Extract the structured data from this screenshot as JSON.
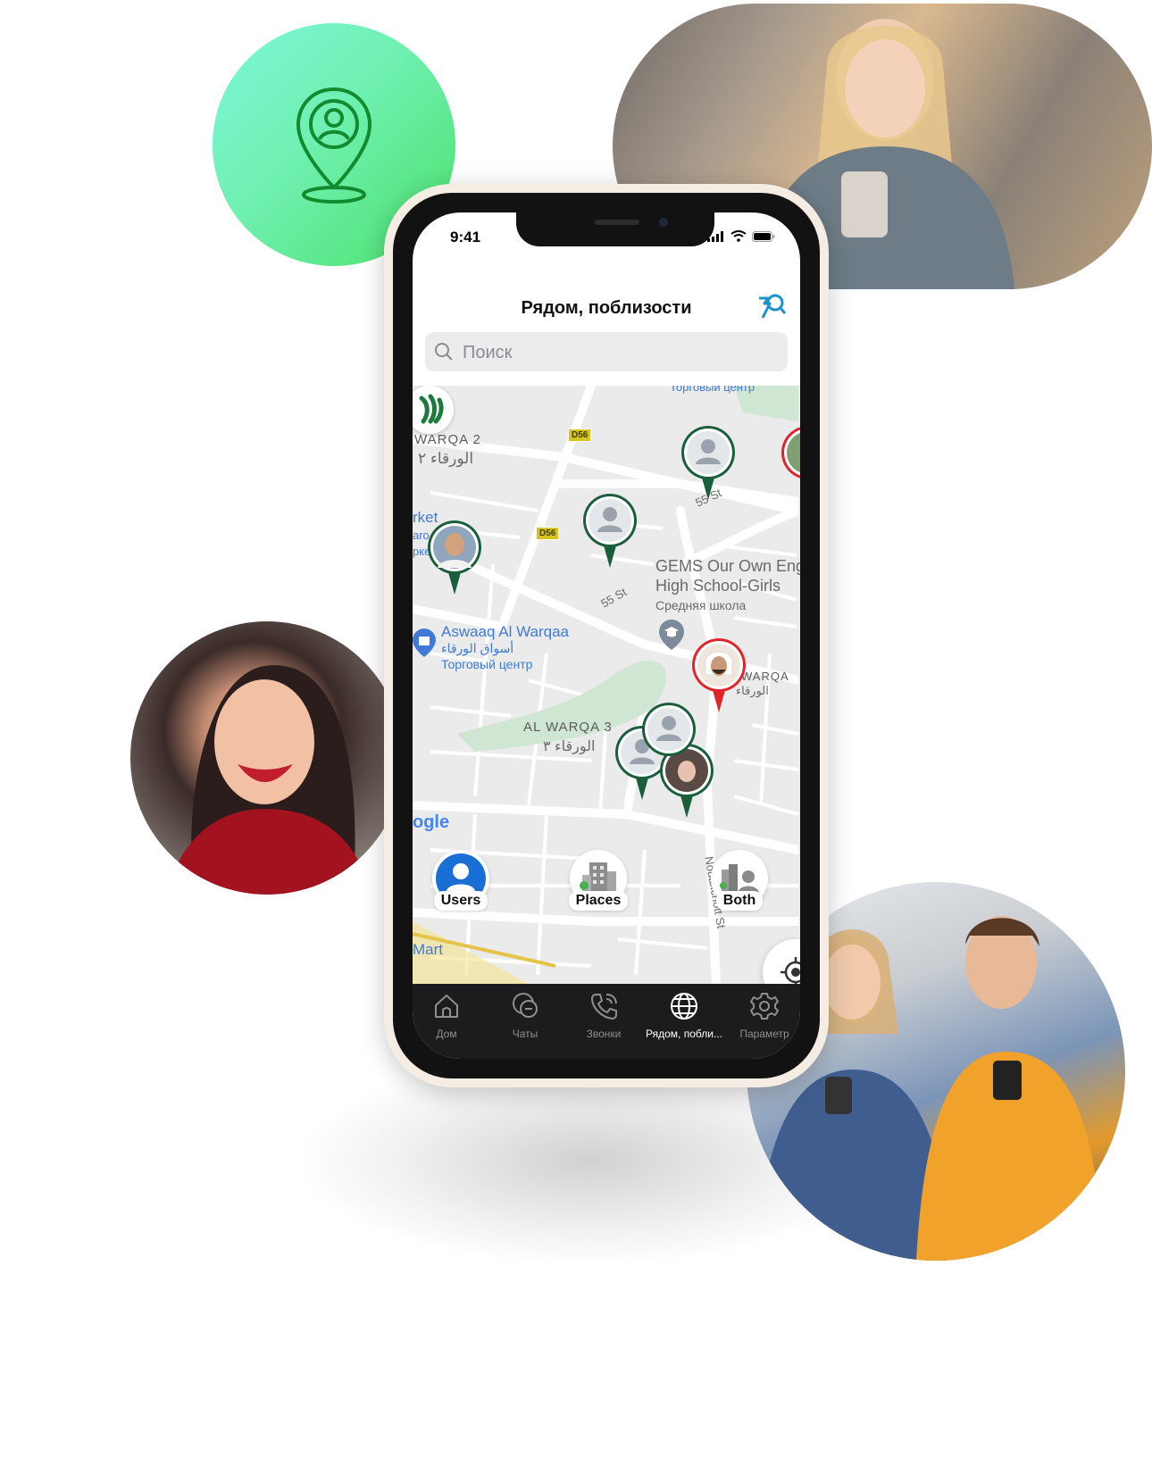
{
  "status_bar": {
    "time": "9:41"
  },
  "header": {
    "title": "Рядом, поблизости"
  },
  "search": {
    "placeholder": "Поиск"
  },
  "map": {
    "labels": {
      "warqa2_en": "WARQA 2",
      "warqa2_ar": "الورقاء ٢",
      "market_en": "rket",
      "market_a": "aro",
      "market_b": "рке",
      "aswaaq_en": "Aswaaq Al Warqaa",
      "aswaaq_ar": "أسواق الورقاء",
      "aswaaq_ru": "Торговый центр",
      "top_ru": "Торговый центр",
      "gems_1": "GEMS Our Own Eng",
      "gems_2": "High School-Girls",
      "gems_ru": "Средняя школа",
      "warqa_right_en": "WARQA",
      "warqa_right_ar": "الورقاء",
      "warqa3_en": "AL WARQA 3",
      "warqa3_ar": "الورقاء ٣",
      "st55_a": "55 St",
      "st55_b": "55 St",
      "nouakchott": "Nouakchott St",
      "mart": "Mart",
      "google": "ogle",
      "d56_a": "D56",
      "d56_b": "D56"
    },
    "filters": [
      {
        "label": "Users",
        "icon": "user-icon"
      },
      {
        "label": "Places",
        "icon": "building-icon"
      },
      {
        "label": "Both",
        "icon": "building-user-icon"
      }
    ]
  },
  "tabbar": {
    "items": [
      {
        "label": "Дом",
        "icon": "home-icon"
      },
      {
        "label": "Чаты",
        "icon": "chat-icon"
      },
      {
        "label": "Звонки",
        "icon": "phone-icon"
      },
      {
        "label": "Рядом, побли...",
        "icon": "globe-icon",
        "active": true
      },
      {
        "label": "Параметр",
        "icon": "gear-icon"
      }
    ]
  },
  "colors": {
    "accent_green": "#1b7a3c",
    "marker_red": "#e2232a",
    "tab_bar": "#1c1c1e",
    "search_icon_blue": "#1f93c9"
  }
}
